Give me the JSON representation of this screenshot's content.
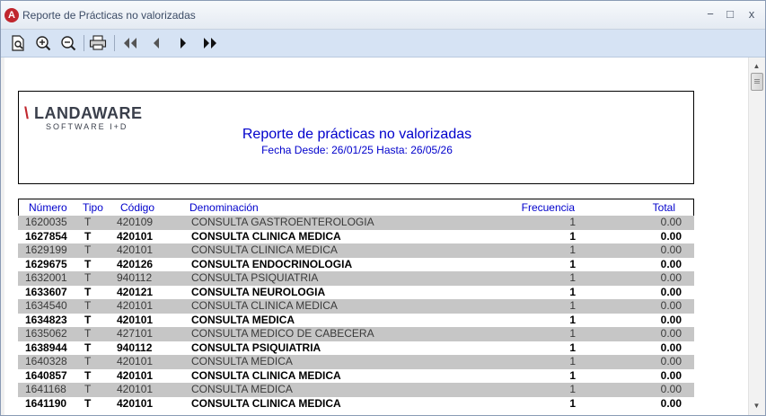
{
  "window": {
    "title": "Reporte de Prácticas no valorizadas",
    "app_icon": "A",
    "minimize": "−",
    "maximize": "□",
    "close": "x"
  },
  "toolbar": {
    "icons": [
      "preview-icon",
      "zoom-in-icon",
      "zoom-out-icon",
      "print-icon",
      "first-page-icon",
      "previous-page-icon",
      "next-page-icon",
      "last-page-icon"
    ]
  },
  "report": {
    "logo_text_accent": "\\",
    "logo_text": "LANDAWARE",
    "logo_subtitle": "SOFTWARE I+D",
    "title": "Reporte de prácticas no valorizadas",
    "date_range": "Fecha Desde: 26/01/25 Hasta: 26/05/26",
    "colors": {
      "heading": "#0000cc",
      "brand_red": "#c0262d",
      "row_shade": "#c6c6c6"
    },
    "columns": {
      "numero": "Número",
      "tipo": "Tipo",
      "codigo": "Código",
      "denominacion": "Denominación",
      "frecuencia": "Frecuencia",
      "total": "Total"
    },
    "rows": [
      {
        "numero": "1620035",
        "tipo": "T",
        "codigo": "420109",
        "denominacion": "CONSULTA GASTROENTEROLOGIA",
        "frecuencia": "1",
        "total": "0.00",
        "shaded": true
      },
      {
        "numero": "1627854",
        "tipo": "T",
        "codigo": "420101",
        "denominacion": "CONSULTA CLINICA MEDICA",
        "frecuencia": "1",
        "total": "0.00",
        "shaded": false
      },
      {
        "numero": "1629199",
        "tipo": "T",
        "codigo": "420101",
        "denominacion": "CONSULTA CLINICA MEDICA",
        "frecuencia": "1",
        "total": "0.00",
        "shaded": true
      },
      {
        "numero": "1629675",
        "tipo": "T",
        "codigo": "420126",
        "denominacion": "CONSULTA ENDOCRINOLOGIA",
        "frecuencia": "1",
        "total": "0.00",
        "shaded": false
      },
      {
        "numero": "1632001",
        "tipo": "T",
        "codigo": "940112",
        "denominacion": "CONSULTA PSIQUIATRIA",
        "frecuencia": "1",
        "total": "0.00",
        "shaded": true
      },
      {
        "numero": "1633607",
        "tipo": "T",
        "codigo": "420121",
        "denominacion": "CONSULTA NEUROLOGIA",
        "frecuencia": "1",
        "total": "0.00",
        "shaded": false
      },
      {
        "numero": "1634540",
        "tipo": "T",
        "codigo": "420101",
        "denominacion": "CONSULTA CLINICA MEDICA",
        "frecuencia": "1",
        "total": "0.00",
        "shaded": true
      },
      {
        "numero": "1634823",
        "tipo": "T",
        "codigo": "420101",
        "denominacion": "CONSULTA MEDICA",
        "frecuencia": "1",
        "total": "0.00",
        "shaded": false
      },
      {
        "numero": "1635062",
        "tipo": "T",
        "codigo": "427101",
        "denominacion": "CONSULTA MEDICO DE CABECERA",
        "frecuencia": "1",
        "total": "0.00",
        "shaded": true
      },
      {
        "numero": "1638944",
        "tipo": "T",
        "codigo": "940112",
        "denominacion": "CONSULTA PSIQUIATRIA",
        "frecuencia": "1",
        "total": "0.00",
        "shaded": false
      },
      {
        "numero": "1640328",
        "tipo": "T",
        "codigo": "420101",
        "denominacion": "CONSULTA MEDICA",
        "frecuencia": "1",
        "total": "0.00",
        "shaded": true
      },
      {
        "numero": "1640857",
        "tipo": "T",
        "codigo": "420101",
        "denominacion": "CONSULTA CLINICA MEDICA",
        "frecuencia": "1",
        "total": "0.00",
        "shaded": false
      },
      {
        "numero": "1641168",
        "tipo": "T",
        "codigo": "420101",
        "denominacion": "CONSULTA MEDICA",
        "frecuencia": "1",
        "total": "0.00",
        "shaded": true
      },
      {
        "numero": "1641190",
        "tipo": "T",
        "codigo": "420101",
        "denominacion": "CONSULTA CLINICA MEDICA",
        "frecuencia": "1",
        "total": "0.00",
        "shaded": false
      }
    ]
  }
}
